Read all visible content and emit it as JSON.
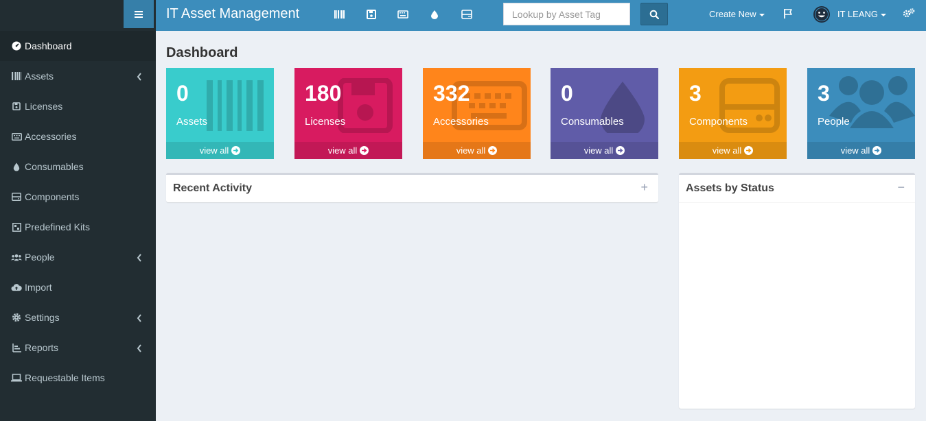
{
  "header": {
    "title": "IT Asset Management",
    "search_placeholder": "Lookup by Asset Tag",
    "create_new_label": "Create New",
    "username": "IT LEANG",
    "nav_icons": [
      "barcode-icon",
      "save-icon",
      "keyboard-icon",
      "tint-icon",
      "hdd-icon"
    ],
    "brand_color": "#3c8dbc"
  },
  "sidebar": {
    "items": [
      {
        "label": "Dashboard",
        "icon": "dashboard-icon",
        "active": true,
        "has_submenu": false
      },
      {
        "label": "Assets",
        "icon": "barcode-icon",
        "active": false,
        "has_submenu": true
      },
      {
        "label": "Licenses",
        "icon": "save-icon",
        "active": false,
        "has_submenu": false
      },
      {
        "label": "Accessories",
        "icon": "keyboard-icon",
        "active": false,
        "has_submenu": false
      },
      {
        "label": "Consumables",
        "icon": "tint-icon",
        "active": false,
        "has_submenu": false
      },
      {
        "label": "Components",
        "icon": "hdd-icon",
        "active": false,
        "has_submenu": false
      },
      {
        "label": "Predefined Kits",
        "icon": "kit-icon",
        "active": false,
        "has_submenu": false
      },
      {
        "label": "People",
        "icon": "users-icon",
        "active": false,
        "has_submenu": true
      },
      {
        "label": "Import",
        "icon": "cloud-upload-icon",
        "active": false,
        "has_submenu": false
      },
      {
        "label": "Settings",
        "icon": "cog-icon",
        "active": false,
        "has_submenu": true
      },
      {
        "label": "Reports",
        "icon": "chart-icon",
        "active": false,
        "has_submenu": true
      },
      {
        "label": "Requestable Items",
        "icon": "laptop-icon",
        "active": false,
        "has_submenu": false
      }
    ]
  },
  "main": {
    "page_title": "Dashboard",
    "tiles": [
      {
        "count": "0",
        "label": "Assets",
        "link": "view all",
        "color": "#39cccc",
        "icon": "barcode-icon"
      },
      {
        "count": "180",
        "label": "Licenses",
        "link": "view all",
        "color": "#d81b60",
        "icon": "save-icon"
      },
      {
        "count": "332",
        "label": "Accessories",
        "link": "view all",
        "color": "#ff851b",
        "icon": "keyboard-icon"
      },
      {
        "count": "0",
        "label": "Consumables",
        "link": "view all",
        "color": "#605ca8",
        "icon": "tint-icon"
      },
      {
        "count": "3",
        "label": "Components",
        "link": "view all",
        "color": "#f39c12",
        "icon": "hdd-icon"
      },
      {
        "count": "3",
        "label": "People",
        "link": "view all",
        "color": "#3c8dbc",
        "icon": "users-icon"
      }
    ],
    "recent_activity": {
      "title": "Recent Activity",
      "tool": "+"
    },
    "assets_by_status": {
      "title": "Assets by Status",
      "tool": "−"
    }
  }
}
